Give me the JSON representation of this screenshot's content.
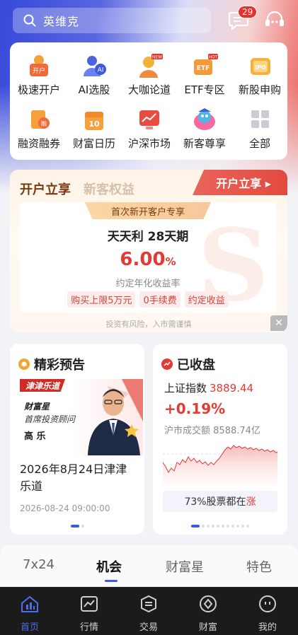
{
  "search": {
    "placeholder": "英维克",
    "message_count": "29"
  },
  "quick_grid": [
    {
      "label": "极速开户",
      "icon": "open-account-icon",
      "tag": "开户"
    },
    {
      "label": "AI选股",
      "icon": "ai-stock-icon",
      "tag": "AI"
    },
    {
      "label": "大咖论道",
      "icon": "expert-talk-icon",
      "tag": "NEW"
    },
    {
      "label": "ETF专区",
      "icon": "etf-icon",
      "tag": "ETF"
    },
    {
      "label": "新股申购",
      "icon": "ipo-icon",
      "tag": "IPO"
    },
    {
      "label": "融资融券",
      "icon": "margin-trading-icon",
      "tag": "融"
    },
    {
      "label": "财富日历",
      "icon": "calendar-icon",
      "tag": "10"
    },
    {
      "label": "沪深市场",
      "icon": "market-icon",
      "tag": ""
    },
    {
      "label": "新客尊享",
      "icon": "new-client-icon",
      "tag": ""
    },
    {
      "label": "全部",
      "icon": "all-apps-icon",
      "tag": ""
    }
  ],
  "hot_tag": "HOT",
  "promo": {
    "tab_active": "开户立享",
    "tab_other": "新客权益",
    "ribbon": "开户立享 ▸",
    "chip": "首次新开客户专享",
    "product": "天天利 28天期",
    "rate": "6.00",
    "rate_unit": "%",
    "rate_label": "约定年化收益率",
    "tags": [
      "购买上限5万元",
      "0手续费",
      "约定收益"
    ],
    "risk": "投资有风险，入市需谨慎"
  },
  "preview_card": {
    "title": "精彩预告",
    "banner_tag": "津津乐道",
    "banner_line1": "财富星",
    "banner_line2": "首席投资顾问",
    "banner_line3": "高 乐",
    "headline": "2026年8月24日津津乐道",
    "date": "2026-08-24 09:00:00"
  },
  "market_card": {
    "title": "已收盘",
    "index_name": "上证指数",
    "index_value": "3889.44",
    "change": "+0.19%",
    "volume_label": "沪市成交额",
    "volume_value": "8588.74亿",
    "breadth_prefix": "73%股票都在",
    "breadth_word": "涨"
  },
  "tabs": [
    "7x24",
    "机会",
    "财富星",
    "特色"
  ],
  "nav": [
    "首页",
    "行情",
    "交易",
    "财富",
    "我的"
  ],
  "colors": {
    "accent": "#3d5ad8",
    "up": "#e33a34",
    "ribbon": "#e24a3f",
    "nav_bg": "#1b1b1b"
  }
}
